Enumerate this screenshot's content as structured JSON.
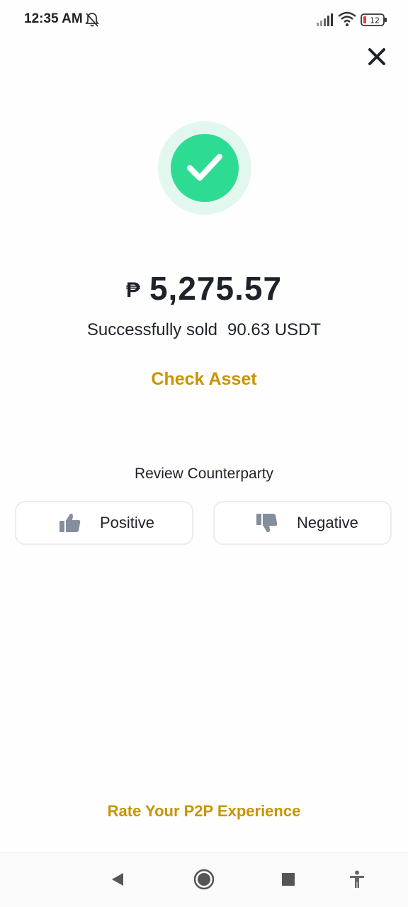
{
  "status_bar": {
    "time": "12:35 AM",
    "battery": "12"
  },
  "amount": {
    "currency_symbol": "₱",
    "value": "5,275.57"
  },
  "sold": {
    "prefix": "Successfully sold",
    "quantity": "90.63 USDT"
  },
  "check_asset_label": "Check Asset",
  "review": {
    "title": "Review Counterparty",
    "positive_label": "Positive",
    "negative_label": "Negative"
  },
  "rate_experience_label": "Rate Your P2P Experience",
  "icons": {
    "status": [
      "bell-off-icon",
      "signal-icon",
      "wifi-icon",
      "battery-icon"
    ],
    "close": "close-icon",
    "success": "checkmark-icon",
    "review": [
      "thumbs-up-icon",
      "thumbs-down-icon"
    ],
    "nav": [
      "back-icon",
      "home-icon",
      "recents-icon",
      "accessibility-icon"
    ]
  },
  "colors": {
    "accent": "#c99400",
    "success": "#2edb93",
    "success_halo": "#e2f8ef",
    "text": "#1e2329"
  }
}
